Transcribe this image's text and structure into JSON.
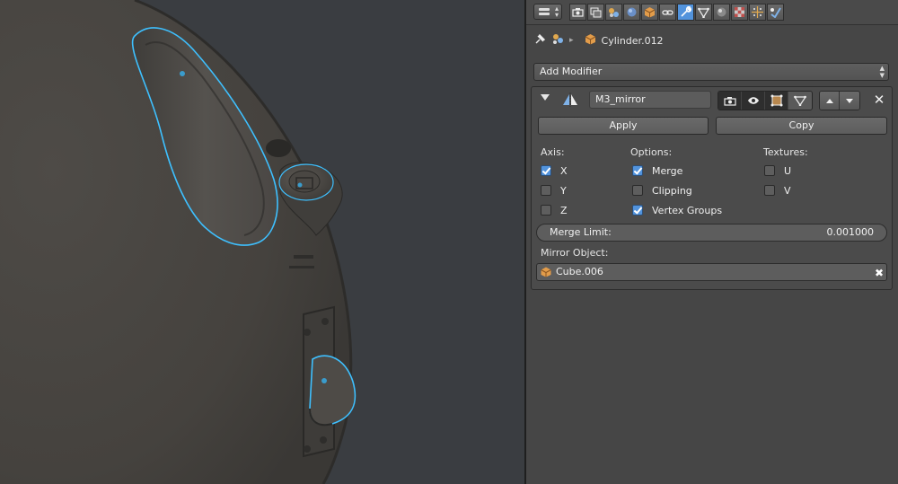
{
  "viewport": {
    "background": "#3a3d41",
    "selection_color": "#3ec0ff"
  },
  "header": {
    "editor_type_icon": "properties-editor-icon",
    "tabs": [
      {
        "icon": "render-icon",
        "active": false
      },
      {
        "icon": "render-layers-icon",
        "active": false
      },
      {
        "icon": "scene-icon",
        "active": false
      },
      {
        "icon": "world-icon",
        "active": false
      },
      {
        "icon": "object-icon",
        "active": false
      },
      {
        "icon": "constraints-icon",
        "active": false
      },
      {
        "icon": "modifiers-wrench-icon",
        "active": true
      },
      {
        "icon": "data-mesh-icon",
        "active": false
      },
      {
        "icon": "material-icon",
        "active": false
      },
      {
        "icon": "texture-icon",
        "active": false
      },
      {
        "icon": "particles-icon",
        "active": false
      },
      {
        "icon": "physics-icon",
        "active": false
      }
    ]
  },
  "breadcrumb": {
    "object_name": "Cylinder.012"
  },
  "add_modifier": {
    "label": "Add Modifier"
  },
  "modifier": {
    "name": "M3_mirror",
    "apply_label": "Apply",
    "copy_label": "Copy",
    "axis": {
      "heading": "Axis:",
      "items": [
        {
          "label": "X",
          "checked": true
        },
        {
          "label": "Y",
          "checked": false
        },
        {
          "label": "Z",
          "checked": false
        }
      ]
    },
    "options": {
      "heading": "Options:",
      "items": [
        {
          "label": "Merge",
          "checked": true
        },
        {
          "label": "Clipping",
          "checked": false
        },
        {
          "label": "Vertex Groups",
          "checked": true
        }
      ]
    },
    "textures": {
      "heading": "Textures:",
      "items": [
        {
          "label": "U",
          "checked": false
        },
        {
          "label": "V",
          "checked": false
        }
      ]
    },
    "merge_limit": {
      "label": "Merge Limit:",
      "value": "0.001000"
    },
    "mirror_object": {
      "label": "Mirror Object:",
      "value": "Cube.006"
    }
  },
  "colors": {
    "accent": "#5293dc",
    "panel_bg": "#464646"
  }
}
